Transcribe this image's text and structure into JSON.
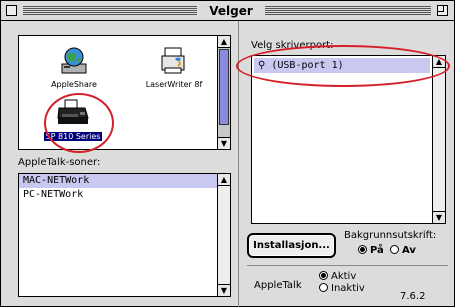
{
  "window": {
    "title": "Velger"
  },
  "devices": [
    {
      "label": "AppleShare",
      "icon": "appleshare-globe-icon"
    },
    {
      "label": "LaserWriter 8f",
      "icon": "laserwriter-printer-icon"
    },
    {
      "label": "SP 810 Series",
      "icon": "inkjet-printer-icon",
      "selected": true
    }
  ],
  "zones": {
    "label": "AppleTalk-soner:",
    "items": [
      {
        "label": "MAC-NETWork",
        "selected": true
      },
      {
        "label": "PC-NETWork",
        "selected": false
      }
    ]
  },
  "port": {
    "label": "Velg skriverport:",
    "items": [
      {
        "label": "(USB-port 1)",
        "icon": "usb-trident-icon",
        "selected": true
      }
    ]
  },
  "install_button": {
    "label": "Installasjon..."
  },
  "background_print": {
    "label": "Bakgrunnsutskrift:",
    "options": [
      {
        "label": "På",
        "selected": true
      },
      {
        "label": "Av",
        "selected": false
      }
    ]
  },
  "appletalk": {
    "label": "AppleTalk",
    "options": [
      {
        "label": "Aktiv",
        "selected": true
      },
      {
        "label": "Inaktiv",
        "selected": false
      }
    ]
  },
  "version": "7.6.2",
  "colors": {
    "selection": "#c8c8f0",
    "annotation_ring": "#d4202a",
    "scroll_thumb": "#8a8adf"
  }
}
